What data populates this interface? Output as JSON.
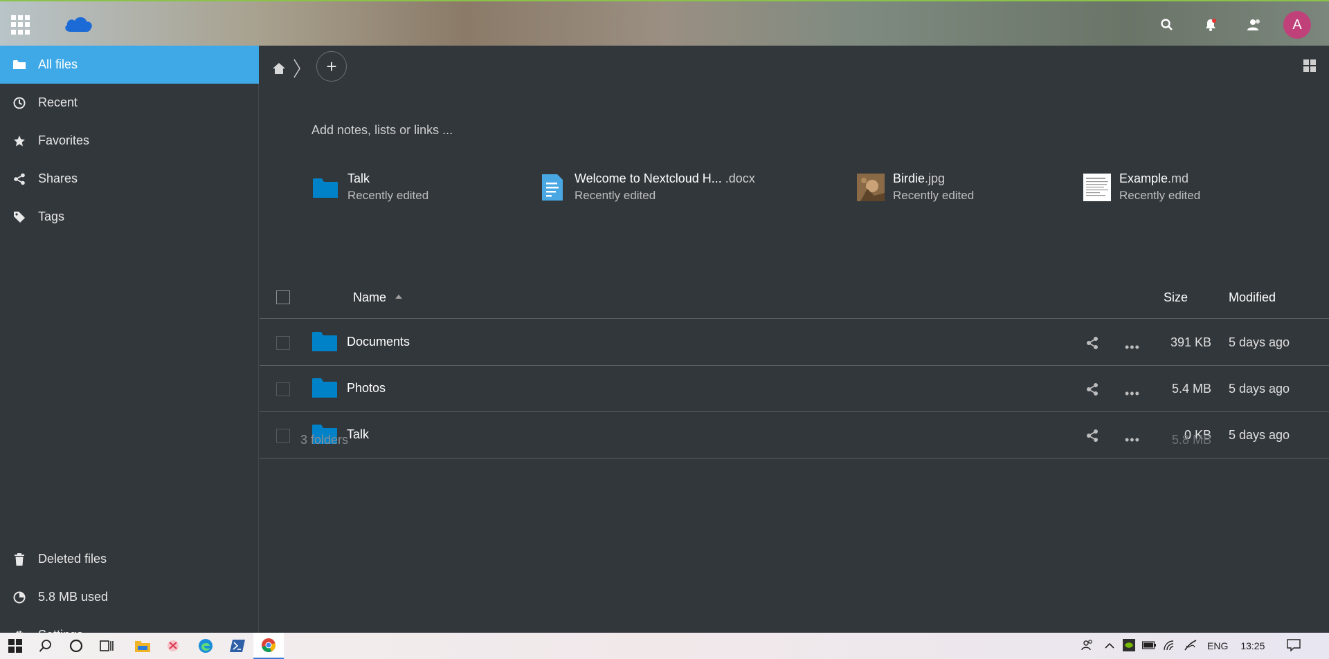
{
  "header": {
    "apps_icon": "apps-grid-icon",
    "logo": "nextcloud-cloud-logo",
    "search_icon": "search-icon",
    "notifications_icon": "bell-icon",
    "contacts_icon": "contacts-icon",
    "avatar_letter": "A",
    "avatar_color": "#c0417a"
  },
  "sidebar": {
    "items": [
      {
        "label": "All files",
        "icon": "folder-icon",
        "active": true
      },
      {
        "label": "Recent",
        "icon": "clock-icon"
      },
      {
        "label": "Favorites",
        "icon": "star-icon"
      },
      {
        "label": "Shares",
        "icon": "share-icon"
      },
      {
        "label": "Tags",
        "icon": "tag-icon"
      }
    ],
    "bottom": [
      {
        "label": "Deleted files",
        "icon": "trash-icon"
      },
      {
        "label": "5.8 MB used",
        "icon": "pie-chart-icon"
      },
      {
        "label": "Settings",
        "icon": "gear-icon"
      }
    ]
  },
  "main": {
    "add_button": "+",
    "notes_placeholder": "Add notes, lists or links ...",
    "recent": [
      {
        "name": "Talk",
        "ext": "",
        "sub": "Recently edited",
        "icon": "folder-icon"
      },
      {
        "name": "Welcome to Nextcloud H...",
        "ext": " .docx",
        "sub": "Recently edited",
        "icon": "document-icon"
      },
      {
        "name": "Birdie",
        "ext": ".jpg",
        "sub": "Recently edited",
        "icon": "image-thumbnail"
      },
      {
        "name": "Example",
        "ext": ".md",
        "sub": "Recently edited",
        "icon": "text-thumbnail"
      }
    ],
    "table": {
      "columns": {
        "name": "Name",
        "size": "Size",
        "modified": "Modified"
      },
      "rows": [
        {
          "name": "Documents",
          "size": "391 KB",
          "modified": "5 days ago"
        },
        {
          "name": "Photos",
          "size": "5.4 MB",
          "modified": "5 days ago"
        },
        {
          "name": "Talk",
          "size": "0 KB",
          "modified": "5 days ago"
        }
      ],
      "summary": {
        "count": "3 folders",
        "size": "5.8 MB"
      }
    }
  },
  "taskbar": {
    "tray": {
      "lang": "ENG",
      "time": "13:25"
    }
  }
}
